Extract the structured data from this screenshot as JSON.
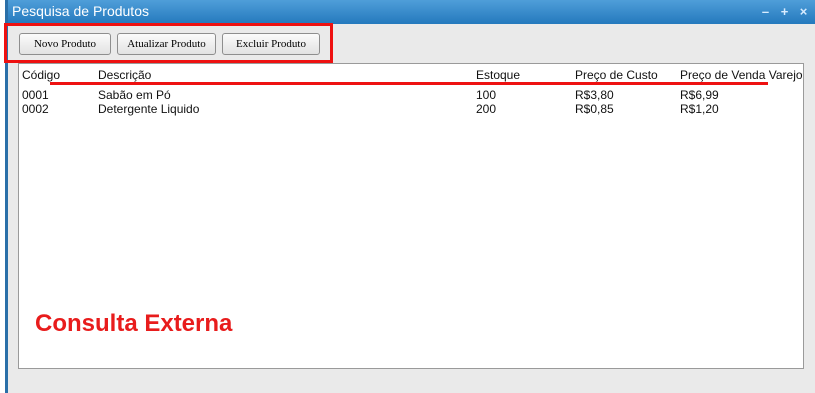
{
  "window": {
    "title": "Pesquisa de Produtos",
    "controls": {
      "minimize": "–",
      "maximize": "+",
      "close": "×"
    }
  },
  "toolbar": {
    "new_label": "Novo Produto",
    "update_label": "Atualizar Produto",
    "delete_label": "Excluir Produto"
  },
  "table": {
    "columns": [
      "Código",
      "Descrição",
      "Estoque",
      "Preço de Custo",
      "Preço de Venda Varejo"
    ],
    "rows": [
      [
        "0001",
        "Sabão em Pó",
        "100",
        "R$3,80",
        "R$6,99"
      ],
      [
        "0002",
        "Detergente Liquido",
        "200",
        "R$0,85",
        "R$1,20"
      ]
    ]
  },
  "annotation": {
    "label": "Consulta Externa",
    "color": "#e81c1c"
  }
}
